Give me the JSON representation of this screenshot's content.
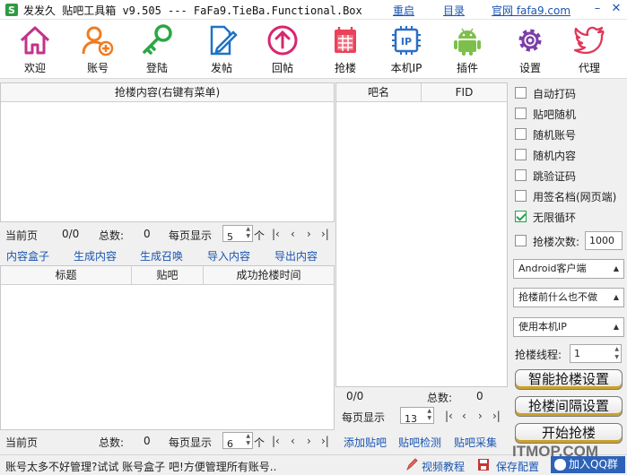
{
  "titlebar": {
    "title": "发发久 贴吧工具箱 v9.505 --- FaFa9.TieBa.Functional.Box",
    "restart": "重启",
    "catalog": "目录",
    "website": "官网 fafa9.com"
  },
  "toolbar": [
    {
      "label": "欢迎",
      "icon": "home-icon"
    },
    {
      "label": "账号",
      "icon": "add-user-icon"
    },
    {
      "label": "登陆",
      "icon": "key-icon"
    },
    {
      "label": "发帖",
      "icon": "edit-document-icon"
    },
    {
      "label": "回帖",
      "icon": "reply-arrow-icon"
    },
    {
      "label": "抢楼",
      "icon": "calendar-icon"
    },
    {
      "label": "本机IP",
      "icon": "ip-chip-icon"
    },
    {
      "label": "插件",
      "icon": "android-icon"
    },
    {
      "label": "设置",
      "icon": "gear-icon"
    },
    {
      "label": "代理",
      "icon": "bird-icon"
    }
  ],
  "content_table": {
    "header": "抢楼内容(右键有菜单)",
    "pager": {
      "current_label": "当前页",
      "page": "0/0",
      "total_label": "总数:",
      "total": "0",
      "per_page_label": "每页显示",
      "per_page": "5",
      "unit": "个"
    }
  },
  "content_links": [
    "内容盒子",
    "生成内容",
    "生成召唤",
    "导入内容",
    "导出内容"
  ],
  "result_table": {
    "headers": [
      "标题",
      "贴吧",
      "成功抢楼时间"
    ],
    "pager": {
      "current_label": "当前页",
      "total_label": "总数:",
      "total": "0",
      "per_page_label": "每页显示",
      "per_page": "6",
      "unit": "个"
    }
  },
  "bar_table": {
    "headers": [
      "吧名",
      "FID"
    ],
    "pager": {
      "page": "0/0",
      "total_label": "总数:",
      "total": "0",
      "per_page_label": "每页显示",
      "per_page": "13"
    },
    "links": [
      "添加贴吧",
      "贴吧检测",
      "贴吧采集"
    ]
  },
  "options": {
    "checkboxes": [
      {
        "label": "自动打码",
        "checked": false
      },
      {
        "label": "贴吧随机",
        "checked": false
      },
      {
        "label": "随机账号",
        "checked": false
      },
      {
        "label": "随机内容",
        "checked": false
      },
      {
        "label": "跳验证码",
        "checked": false
      },
      {
        "label": "用签名档(网页端)",
        "checked": false
      },
      {
        "label": "无限循环",
        "checked": true
      }
    ],
    "floor_count_label": "抢楼次数:",
    "floor_count": "1000",
    "client_select": "Android客户端",
    "before_select": "抢楼前什么也不做",
    "ip_select": "使用本机IP",
    "threads_label": "抢楼线程:",
    "threads": "1",
    "smart_btn": "智能抢楼设置",
    "interval_btn": "抢楼间隔设置",
    "start_btn": "开始抢楼"
  },
  "status": {
    "message": "账号太多不好管理?试试 账号盒子 吧!方便管理所有账号..",
    "video": "视频教程",
    "save": "保存配置",
    "qq": "加入QQ群"
  },
  "watermark": "ITMOP.COM",
  "colors": {
    "accent_link": "#1a55b0",
    "check_green": "#22a34a",
    "button_gold": "#c9a22a"
  }
}
